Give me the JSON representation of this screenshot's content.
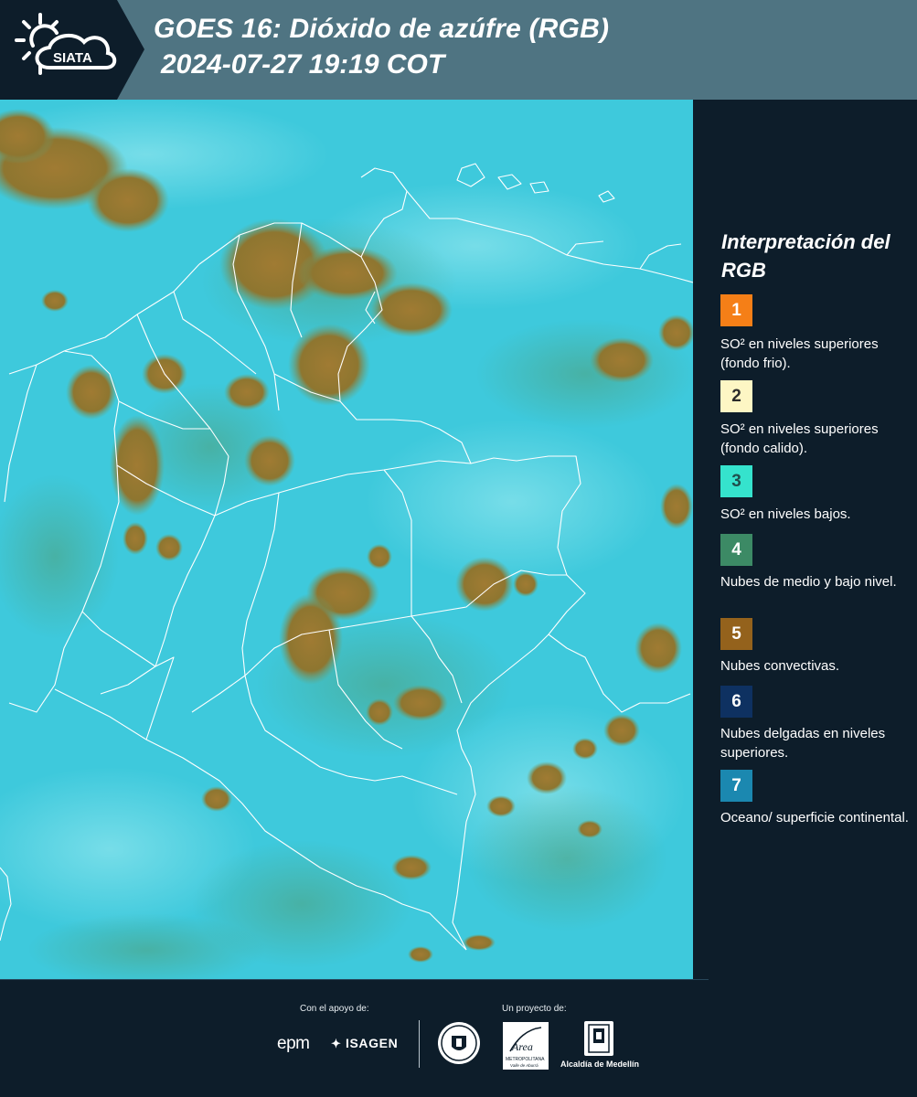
{
  "header": {
    "title_line1": "GOES 16: Dióxido de azúfre (RGB)",
    "title_line2": "2024-07-27 19:19 COT",
    "logo_text": "SIATA",
    "background_color": "#4f7482",
    "logo_background_color": "#0d1d2a"
  },
  "map": {
    "subject": "Colombia y alrededores",
    "background_color": "#3ec9dc",
    "convective_cloud_color": "#9c7a33",
    "border_line_color": "#ffffff"
  },
  "legend": {
    "title": "Interpretación del RGB",
    "items": [
      {
        "number": "1",
        "color": "#f57f17",
        "number_color": "#ffffff",
        "text": "SO² en niveles superiores (fondo frio)."
      },
      {
        "number": "2",
        "color": "#fdf6c4",
        "number_color": "#2b2b2b",
        "text": "SO² en niveles superiores (fondo calido)."
      },
      {
        "number": "3",
        "color": "#35e3cd",
        "number_color": "#1f4f4c",
        "text": "SO² en niveles bajos."
      },
      {
        "number": "4",
        "color": "#3c8a65",
        "number_color": "#ffffff",
        "text": "Nubes de medio y bajo nivel."
      },
      {
        "number": "5",
        "color": "#94621c",
        "number_color": "#ffffff",
        "text": "Nubes convectivas."
      },
      {
        "number": "6",
        "color": "#0e3161",
        "number_color": "#ffffff",
        "text": "Nubes delgadas en niveles superiores."
      },
      {
        "number": "7",
        "color": "#1b88b0",
        "number_color": "#ffffff",
        "text": "Oceano/ superficie continental."
      }
    ]
  },
  "footer": {
    "support_caption": "Con el apoyo de:",
    "project_caption": "Un proyecto de:",
    "sponsors": [
      "epm",
      "ISAGEN"
    ],
    "partners": [
      "Área Metropolitana Valle de Aburrá",
      "Alcaldía de Medellín"
    ],
    "epm_text": "epm",
    "isagen_text": "ISAGEN",
    "alcaldia_text": "Alcaldía de Medellín",
    "area_logo_text": "Área",
    "area_logo_subtext": "METROPOLITANA",
    "area_logo_subtext2": "Valle de Aburrá"
  }
}
